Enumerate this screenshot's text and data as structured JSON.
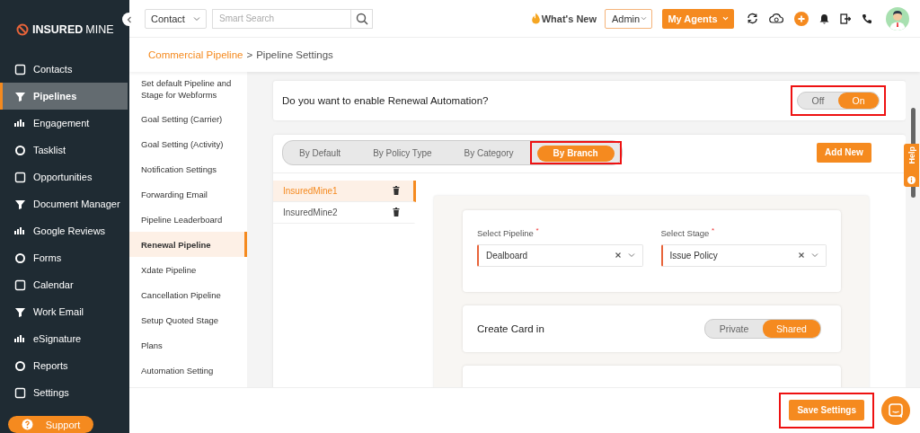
{
  "brand": {
    "bold": "INSURED",
    "light": "MINE"
  },
  "nav": [
    {
      "label": "Contacts",
      "selected": false
    },
    {
      "label": "Pipelines",
      "selected": true
    },
    {
      "label": "Engagement",
      "selected": false
    },
    {
      "label": "Tasklist",
      "selected": false
    },
    {
      "label": "Opportunities",
      "selected": false
    },
    {
      "label": "Document Manager",
      "selected": false
    },
    {
      "label": "Google Reviews",
      "selected": false
    },
    {
      "label": "Forms",
      "selected": false
    },
    {
      "label": "Calendar",
      "selected": false
    },
    {
      "label": "Work Email",
      "selected": false
    },
    {
      "label": "eSignature",
      "selected": false
    },
    {
      "label": "Reports",
      "selected": false
    },
    {
      "label": "Settings",
      "selected": false
    }
  ],
  "support": "Support",
  "topbar": {
    "module_select": "Contact",
    "search_placeholder": "Smart Search",
    "whats_new": "What's New",
    "role_select": "Admin",
    "agents_button": "My Agents"
  },
  "breadcrumb": {
    "parent": "Commercial Pipeline",
    "separator": ">",
    "current": "Pipeline Settings"
  },
  "settings_menu": [
    {
      "label": "Set default Pipeline and Stage for Webforms",
      "selected": false
    },
    {
      "label": "Goal Setting (Carrier)",
      "selected": false
    },
    {
      "label": "Goal Setting (Activity)",
      "selected": false
    },
    {
      "label": "Notification Settings",
      "selected": false
    },
    {
      "label": "Forwarding Email",
      "selected": false
    },
    {
      "label": "Pipeline Leaderboard",
      "selected": false
    },
    {
      "label": "Renewal Pipeline",
      "selected": true
    },
    {
      "label": "Xdate Pipeline",
      "selected": false
    },
    {
      "label": "Cancellation Pipeline",
      "selected": false
    },
    {
      "label": "Setup Quoted Stage",
      "selected": false
    },
    {
      "label": "Plans",
      "selected": false
    },
    {
      "label": "Automation Setting",
      "selected": false
    }
  ],
  "renewal": {
    "question": "Do you want to enable Renewal Automation?",
    "highlighted": true,
    "toggle": [
      {
        "label": "Off",
        "selected": false
      },
      {
        "label": "On",
        "selected": true
      }
    ]
  },
  "mode_tabs": [
    {
      "label": "By Default",
      "selected": false,
      "highlighted": false
    },
    {
      "label": "By Policy Type",
      "selected": false,
      "highlighted": false
    },
    {
      "label": "By Category",
      "selected": false,
      "highlighted": false
    },
    {
      "label": "By Branch",
      "selected": true,
      "highlighted": true
    }
  ],
  "add_new": "Add New",
  "branches": [
    {
      "name": "InsuredMine1",
      "selected": true
    },
    {
      "name": "InsuredMine2",
      "selected": false
    }
  ],
  "fields": [
    {
      "label": "Select Pipeline",
      "mark": "*",
      "value": "Dealboard"
    },
    {
      "label": "Select Stage",
      "mark": "*",
      "value": "Issue Policy"
    }
  ],
  "create_card": {
    "label": "Create Card in",
    "options": [
      {
        "label": "Private",
        "selected": false
      },
      {
        "label": "Shared",
        "selected": true
      }
    ]
  },
  "help": "Help",
  "save": {
    "label": "Save Settings",
    "highlighted": true
  }
}
